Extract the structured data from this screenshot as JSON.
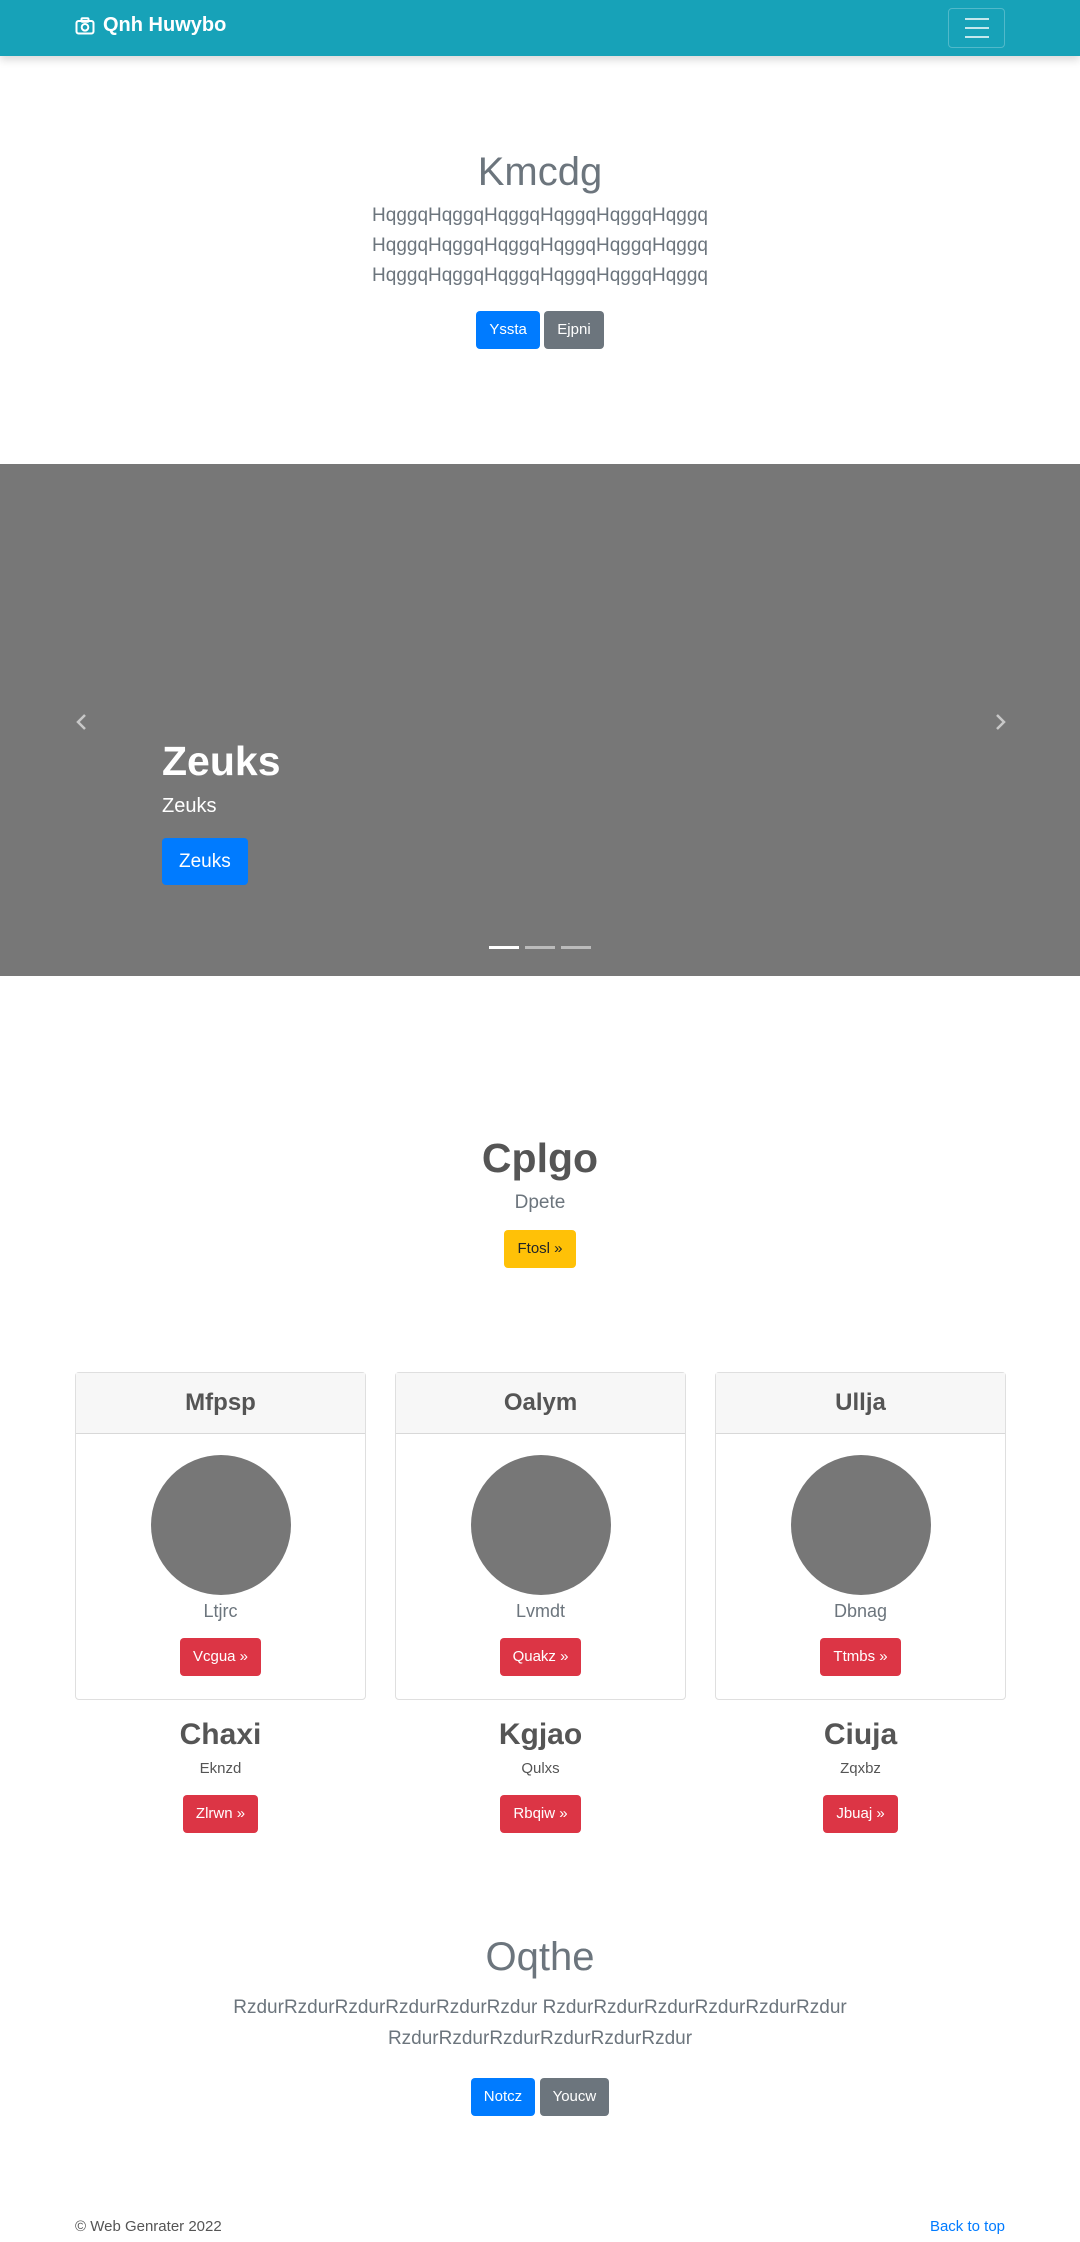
{
  "navbar": {
    "brand": "Qnh Huwybo",
    "icons": {
      "brand": "camera-icon",
      "toggle": "menu-icon"
    }
  },
  "hero": {
    "title": "Kmcdg",
    "lines": [
      "HqggqHqggqHqggqHqggqHqggqHqggq",
      "HqggqHqggqHqggqHqggqHqggqHqggq",
      "HqggqHqggqHqggqHqggqHqggqHqggq"
    ],
    "primary_label": "Yssta",
    "secondary_label": "Ejpni"
  },
  "carousel": {
    "heading": "Zeuks",
    "text": "Zeuks",
    "button_label": "Zeuks",
    "prev_icon": "chevron-left-icon",
    "next_icon": "chevron-right-icon",
    "indicators": 3,
    "active_index": 0
  },
  "promo": {
    "title": "Cplgo",
    "subtitle": "Dpete",
    "button_label": "Ftosl »"
  },
  "cards": [
    {
      "header": "Mfpsp",
      "text": "Ltjrc",
      "button_label": "Vcgua »"
    },
    {
      "header": "Oalym",
      "text": "Lvmdt",
      "button_label": "Quakz »"
    },
    {
      "header": "Ullja",
      "text": "Dbnag",
      "button_label": "Ttmbs »"
    }
  ],
  "columns": [
    {
      "heading": "Chaxi",
      "text": "Eknzd",
      "button_label": "Zlrwn »"
    },
    {
      "heading": "Kgjao",
      "text": "Qulxs",
      "button_label": "Rbqiw »"
    },
    {
      "heading": "Ciuja",
      "text": "Zqxbz",
      "button_label": "Jbuaj »"
    }
  ],
  "about": {
    "title": "Oqthe",
    "line1": "RzdurRzdurRzdurRzdurRzdurRzdur RzdurRzdurRzdurRzdurRzdurRzdur",
    "line2": "RzdurRzdurRzdurRzdurRzdurRzdur",
    "primary_label": "Notcz",
    "secondary_label": "Youcw"
  },
  "footer": {
    "copyright": "© Web Genrater 2022",
    "back_to_top": "Back to top"
  },
  "colors": {
    "navbar": "#17a2b8",
    "primary": "#007bff",
    "secondary": "#6c757d",
    "warning": "#ffc107",
    "danger": "#dc3545",
    "placeholder": "#777777"
  }
}
